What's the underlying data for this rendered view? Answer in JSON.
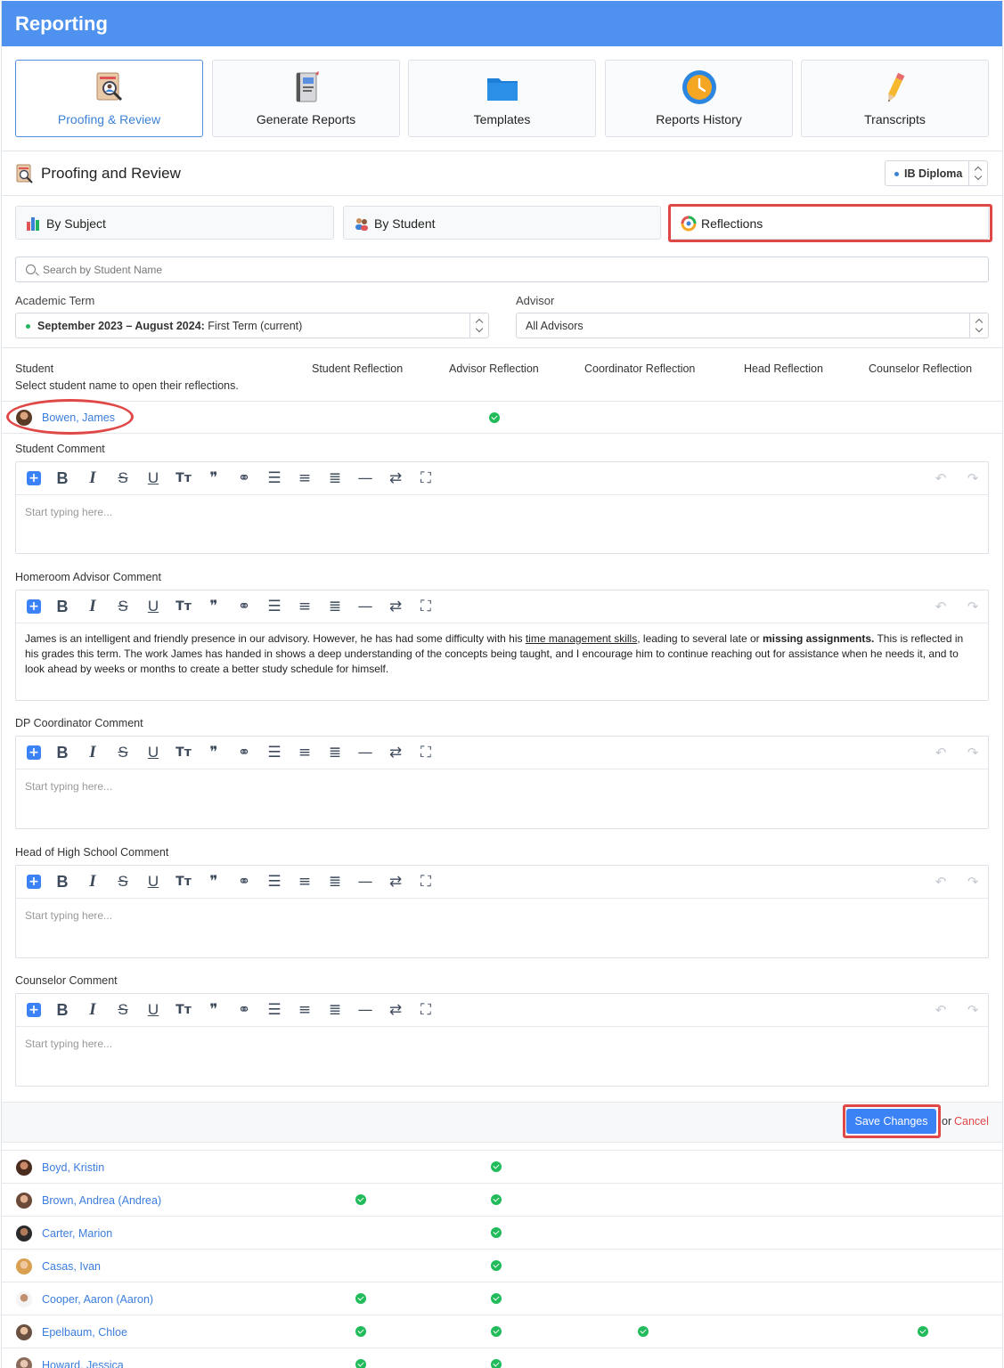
{
  "header": {
    "title": "Reporting"
  },
  "tiles": [
    {
      "label": "Proofing & Review",
      "icon": "proofing-review-icon"
    },
    {
      "label": "Generate Reports",
      "icon": "report-cards-icon"
    },
    {
      "label": "Templates",
      "icon": "folder-icon"
    },
    {
      "label": "Reports History",
      "icon": "clock-icon"
    },
    {
      "label": "Transcripts",
      "icon": "pencil-icon"
    }
  ],
  "section": {
    "title": "Proofing and Review",
    "program": "IB Diploma"
  },
  "views": [
    {
      "label": "By Subject",
      "icon": "bar-chart-icon"
    },
    {
      "label": "By Student",
      "icon": "students-icon"
    },
    {
      "label": "Reflections",
      "icon": "reflections-icon"
    }
  ],
  "search": {
    "placeholder": "Search by Student Name"
  },
  "filters": {
    "term_label": "Academic Term",
    "term_bold": "September 2023 – August 2024:",
    "term_rest": " First Term (current)",
    "advisor_label": "Advisor",
    "advisor_value": "All Advisors"
  },
  "columns": {
    "student": "Student",
    "student_sub": "Select student name to open their reflections.",
    "student_reflection": "Student Reflection",
    "advisor_reflection": "Advisor Reflection",
    "coordinator_reflection": "Coordinator Reflection",
    "head_reflection": "Head Reflection",
    "counselor_reflection": "Counselor Reflection"
  },
  "selected_student": {
    "name": "Bowen, James",
    "checks": [
      false,
      true,
      false,
      false,
      false
    ]
  },
  "comments": {
    "student_label": "Student Comment",
    "advisor_label": "Homeroom Advisor Comment",
    "coordinator_label": "DP Coordinator Comment",
    "head_label": "Head of High School Comment",
    "counselor_label": "Counselor Comment",
    "placeholder": "Start typing here...",
    "advisor_text": {
      "p1": "James is an intelligent and friendly presence in our advisory. However, he has had some difficulty with his ",
      "u1": "time management skills",
      "p2": ", leading to several late or ",
      "b1": "missing assignments.",
      "p3": " This is reflected in his grades this term. The work James has handed in shows a deep understanding of the concepts being taught, and I encourage him to continue reaching out for assistance when he needs it, and to look ahead by weeks or months to create a better study schedule for himself."
    }
  },
  "actions": {
    "save": "Save Changes",
    "or": "or",
    "cancel": "Cancel"
  },
  "students": [
    {
      "name": "Boyd, Kristin",
      "checks": [
        false,
        true,
        false,
        false,
        false
      ]
    },
    {
      "name": "Brown, Andrea (Andrea)",
      "checks": [
        true,
        true,
        false,
        false,
        false
      ]
    },
    {
      "name": "Carter, Marion",
      "checks": [
        false,
        true,
        false,
        false,
        false
      ]
    },
    {
      "name": "Casas, Ivan",
      "checks": [
        false,
        true,
        false,
        false,
        false
      ]
    },
    {
      "name": "Cooper, Aaron (Aaron)",
      "checks": [
        true,
        true,
        false,
        false,
        false
      ]
    },
    {
      "name": "Epelbaum, Chloe",
      "checks": [
        true,
        true,
        true,
        false,
        true
      ]
    },
    {
      "name": "Howard, Jessica",
      "checks": [
        true,
        true,
        false,
        false,
        false
      ]
    }
  ],
  "colors": {
    "header": "#4f91ee",
    "accent": "#3b82f6",
    "link": "#3b7ddd",
    "highlight": "#e04848",
    "check": "#22bb5b"
  }
}
